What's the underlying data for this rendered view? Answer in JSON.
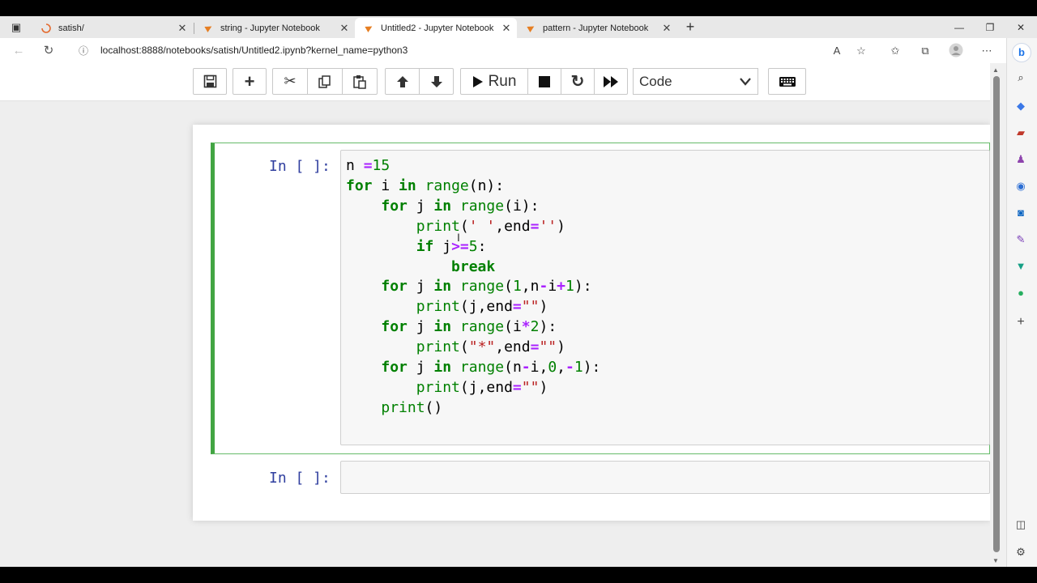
{
  "browser": {
    "tabs": [
      {
        "title": "satish/",
        "icon": "loading-spinner-icon"
      },
      {
        "title": "string - Jupyter Notebook",
        "icon": "jupyter-icon"
      },
      {
        "title": "Untitled2 - Jupyter Notebook",
        "icon": "jupyter-icon",
        "active": true
      },
      {
        "title": "pattern - Jupyter Notebook",
        "icon": "jupyter-icon"
      }
    ],
    "url": "localhost:8888/notebooks/satish/Untitled2.ipynb?kernel_name=python3"
  },
  "toolbar": {
    "run_label": "Run",
    "cell_type": "Code"
  },
  "cells": [
    {
      "prompt": "In [ ]:"
    },
    {
      "prompt": "In [ ]:"
    }
  ],
  "colors": {
    "selected_cell_border": "#42a543",
    "prompt": "#303f9f",
    "keyword": "#008000",
    "operator": "#aa22ff",
    "string": "#ba2121"
  }
}
